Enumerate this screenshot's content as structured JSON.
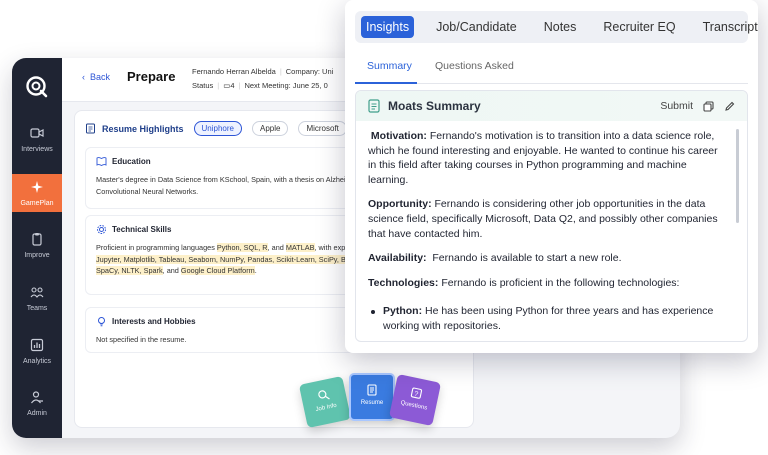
{
  "sidebar": {
    "items": [
      {
        "label": "Interviews",
        "icon": "video-icon"
      },
      {
        "label": "GamePlan",
        "icon": "sparkle-icon"
      },
      {
        "label": "Improve",
        "icon": "clipboard-icon"
      },
      {
        "label": "Teams",
        "icon": "team-icon"
      },
      {
        "label": "Analytics",
        "icon": "chart-icon"
      },
      {
        "label": "Admin",
        "icon": "admin-icon"
      }
    ],
    "active_color": "#f2703d"
  },
  "header": {
    "back": "Back",
    "title": "Prepare",
    "candidate_name": "Fernando Herran Albelda",
    "company": "Company: Uni",
    "status": "Status",
    "count": "4",
    "next_meeting": "Next Meeting: June 25, 0"
  },
  "highlights": {
    "title": "Resume Highlights",
    "chips": [
      "Uniphore",
      "Apple",
      "Microsoft"
    ],
    "education": {
      "title": "Education",
      "text": "Master's degree in Data Science from KSchool, Spain, with a thesis on Alzheimer's disease detection using Convolutional Neural Networks."
    },
    "skills": {
      "title": "Technical Skills",
      "intro": "Proficient in programming languages ",
      "t1": "Python, SQL, R",
      "t2": ", and ",
      "t3": "MATLAB",
      "t4": ", with expertise in data skills such as ",
      "t5": "Jupyter, Matplotlib, Tableau, Seaborn, NumPy, Pandas, Scikit-Learn, SciPy, BeautifulSoup, Keras, TensorFlow, SpaCy, NLTK, Spark",
      "t6": ", and ",
      "t7": "Google Cloud Platform",
      "t8": "."
    },
    "interests": {
      "title": "Interests and Hobbies",
      "text": "Not specified in the resume."
    }
  },
  "tiles": {
    "job_info": "Job Info",
    "resume": "Resume",
    "questions": "Questions"
  },
  "panel": {
    "tabs": [
      "Insights",
      "Job/Candidate",
      "Notes",
      "Recruiter EQ",
      "Transcript"
    ],
    "subtabs": [
      "Summary",
      "Questions Asked"
    ],
    "summary_title": "Moats Summary",
    "submit": "Submit",
    "sections": {
      "motivation_label": "Motivation:",
      "motivation": "Fernando's motivation is to transition into a data science role, which he found interesting and enjoyable. He wanted to continue his career in this field after taking courses in Python programming and machine learning.",
      "opportunity_label": "Opportunity:",
      "opportunity": "Fernando is considering other job opportunities in the data science field, specifically Microsoft, Data Q2, and possibly other companies that have contacted him.",
      "availability_label": "Availability:",
      "availability": "Fernando is available to start a new role.",
      "technologies_label": "Technologies:",
      "technologies": "Fernando is proficient in the following technologies:",
      "python_label": "Python:",
      "python": "He has been using Python for three years and has experience working with repositories."
    },
    "accent": "#2b62d9"
  }
}
